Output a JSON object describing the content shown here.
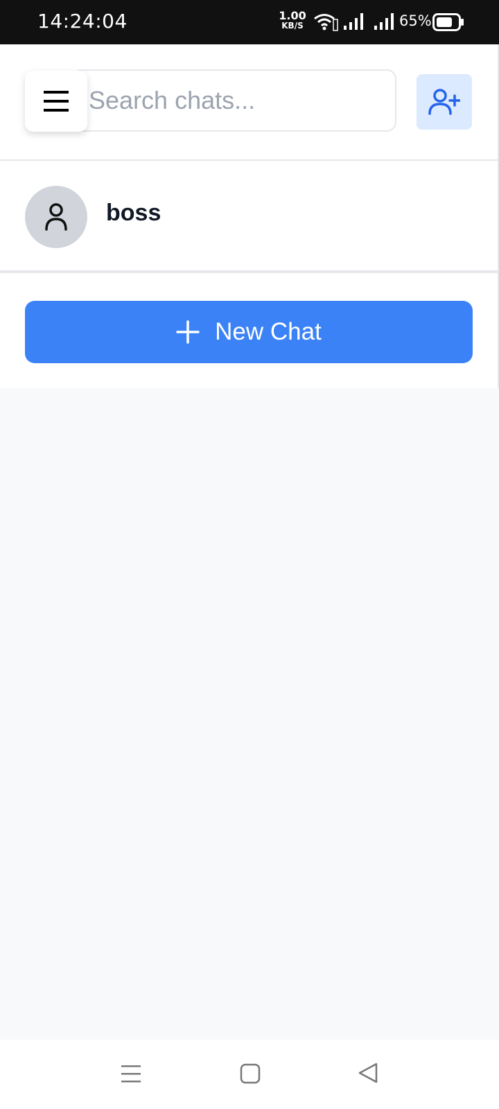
{
  "status_bar": {
    "time": "14:24:04",
    "net_speed_value": "1.00",
    "net_speed_unit": "KB/S",
    "battery_percent": "65%"
  },
  "search": {
    "placeholder": "Search chats...",
    "value": ""
  },
  "chats": [
    {
      "name": "boss"
    }
  ],
  "new_chat": {
    "label": "New Chat"
  },
  "colors": {
    "accent": "#3b82f6",
    "add_user_bg": "#dbeafe",
    "add_user_icon": "#2563eb",
    "avatar_bg": "#d1d5db",
    "page_bg": "#f8f9fb"
  },
  "icons": {
    "menu": "menu-icon",
    "add_user": "user-plus-icon",
    "avatar": "user-icon",
    "new_chat": "plus-icon"
  }
}
